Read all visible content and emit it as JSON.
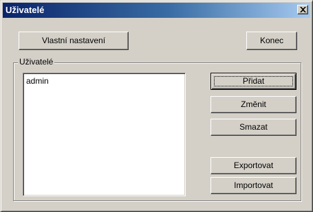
{
  "window": {
    "title": "Uživatelé",
    "close_label": "×"
  },
  "top_buttons": {
    "custom_settings": "Vlastní nastavení",
    "exit": "Konec"
  },
  "users_group": {
    "label": "Uživatelé",
    "items": [
      "admin"
    ]
  },
  "side_buttons": {
    "add": "Přidat",
    "edit": "Změnit",
    "delete": "Smazat",
    "export": "Exportovat",
    "import": "Importovat"
  },
  "colors": {
    "face": "#d4d0c8",
    "title_start": "#0a246a",
    "title_end": "#a6caf0"
  }
}
